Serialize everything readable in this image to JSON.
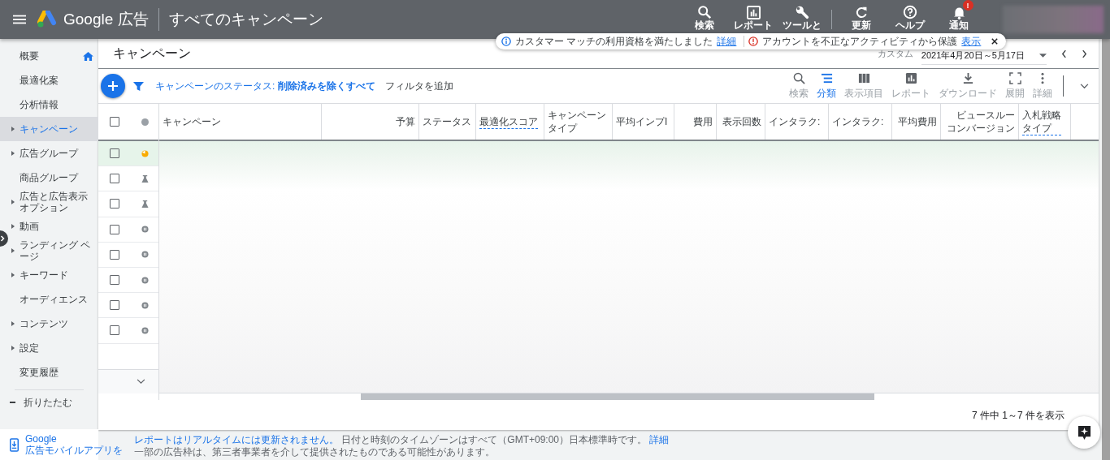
{
  "header": {
    "product": "Google 広告",
    "page_title": "すべてのキャンペーン",
    "tools": [
      {
        "kind": "search",
        "label": "検索"
      },
      {
        "kind": "report",
        "label": "レポート"
      },
      {
        "kind": "tools",
        "label": "ツールと"
      },
      {
        "kind": "refresh",
        "label": "更新"
      },
      {
        "kind": "help",
        "label": "ヘルプ"
      },
      {
        "kind": "bell",
        "label": "通知",
        "badge": "!"
      }
    ]
  },
  "notices": [
    {
      "kind": "info",
      "text": "カスタマー マッチの利用資格を満たしました",
      "link": "詳細"
    },
    {
      "kind": "error",
      "text": "アカウントを不正なアクティビティから保護",
      "link": "表示"
    }
  ],
  "sidebar": {
    "items": [
      {
        "label": "概要",
        "expandable": false,
        "selected": false,
        "home": true
      },
      {
        "label": "最適化案",
        "expandable": false,
        "selected": false
      },
      {
        "label": "分析情報",
        "expandable": false,
        "selected": false
      },
      {
        "label": "キャンペーン",
        "expandable": true,
        "selected": true
      },
      {
        "label": "広告グループ",
        "expandable": true,
        "selected": false
      },
      {
        "label": "商品グループ",
        "expandable": false,
        "selected": false
      },
      {
        "label": "広告と広告表示オプション",
        "expandable": true,
        "selected": false
      },
      {
        "label": "動画",
        "expandable": true,
        "selected": false
      },
      {
        "label": "ランディング ページ",
        "expandable": true,
        "selected": false
      },
      {
        "label": "キーワード",
        "expandable": true,
        "selected": false
      },
      {
        "label": "オーディエンス",
        "expandable": false,
        "selected": false
      },
      {
        "label": "コンテンツ",
        "expandable": true,
        "selected": false
      },
      {
        "label": "設定",
        "expandable": true,
        "selected": false
      },
      {
        "label": "変更履歴",
        "expandable": false,
        "selected": false
      }
    ],
    "collapse": "折りたたむ",
    "app_promo": [
      "Google",
      "広告モバイルアプリを"
    ]
  },
  "page": {
    "title": "キャンペーン",
    "date_label": "カスタム",
    "date_range": "2021年4月20日～5月17日"
  },
  "toolbar": {
    "filter_label": "キャンペーンのステータス:",
    "filter_value": "削除済みを除くすべて",
    "add_filter": "フィルタを追加",
    "actions": [
      {
        "kind": "search",
        "label": "検索",
        "selected": false
      },
      {
        "kind": "segment",
        "label": "分類",
        "selected": true
      },
      {
        "kind": "columns",
        "label": "表示項目",
        "selected": false
      },
      {
        "kind": "report",
        "label": "レポート",
        "selected": false
      },
      {
        "kind": "download",
        "label": "ダウンロード",
        "selected": false
      },
      {
        "kind": "expand",
        "label": "展開",
        "selected": false
      },
      {
        "kind": "more",
        "label": "詳細",
        "selected": false
      }
    ]
  },
  "table": {
    "select_all": false,
    "columns": [
      {
        "lines": [
          "キャンペーン"
        ],
        "dashed": false
      },
      {
        "lines": [
          "予算"
        ],
        "dashed": false
      },
      {
        "lines": [
          "ステータス"
        ],
        "dashed": false
      },
      {
        "lines": [
          "最適化スコア"
        ],
        "dashed": true
      },
      {
        "lines": [
          "キャンペーン",
          "タイプ"
        ],
        "dashed": false
      },
      {
        "lines": [
          "平均インプI"
        ],
        "dashed": false
      },
      {
        "lines": [
          "費用"
        ],
        "dashed": false
      },
      {
        "lines": [
          "表示回数"
        ],
        "dashed": false
      },
      {
        "lines": [
          "インタラク:"
        ],
        "dashed": false
      },
      {
        "lines": [
          "インタラク:"
        ],
        "dashed": false
      },
      {
        "lines": [
          "平均費用"
        ],
        "dashed": false
      },
      {
        "lines": [
          "ビュースルー",
          "コンバージョン"
        ],
        "dashed": false
      },
      {
        "lines": [
          "入札戦略",
          "タイプ"
        ],
        "dashed": true
      }
    ],
    "rows": [
      {
        "kind": "limited",
        "checked": false,
        "highlighted": true
      },
      {
        "kind": "experiment",
        "checked": false,
        "highlighted": false
      },
      {
        "kind": "experiment",
        "checked": false,
        "highlighted": false
      },
      {
        "kind": "paused",
        "checked": false,
        "highlighted": false
      },
      {
        "kind": "paused",
        "checked": false,
        "highlighted": false
      },
      {
        "kind": "paused",
        "checked": false,
        "highlighted": false
      },
      {
        "kind": "paused",
        "checked": false,
        "highlighted": false
      },
      {
        "kind": "paused",
        "checked": false,
        "highlighted": false
      }
    ],
    "count": "7 件中 1～7 件を表示"
  },
  "footer": {
    "realtime_note": "レポートはリアルタイムには更新されません。",
    "timezone_note": "日付と時刻のタイムゾーンはすべて（GMT+09:00）日本標準時です。",
    "link": "詳細",
    "second_line": "一部の広告枠は、第三者事業者を介して提供されたものである可能性があります。"
  }
}
